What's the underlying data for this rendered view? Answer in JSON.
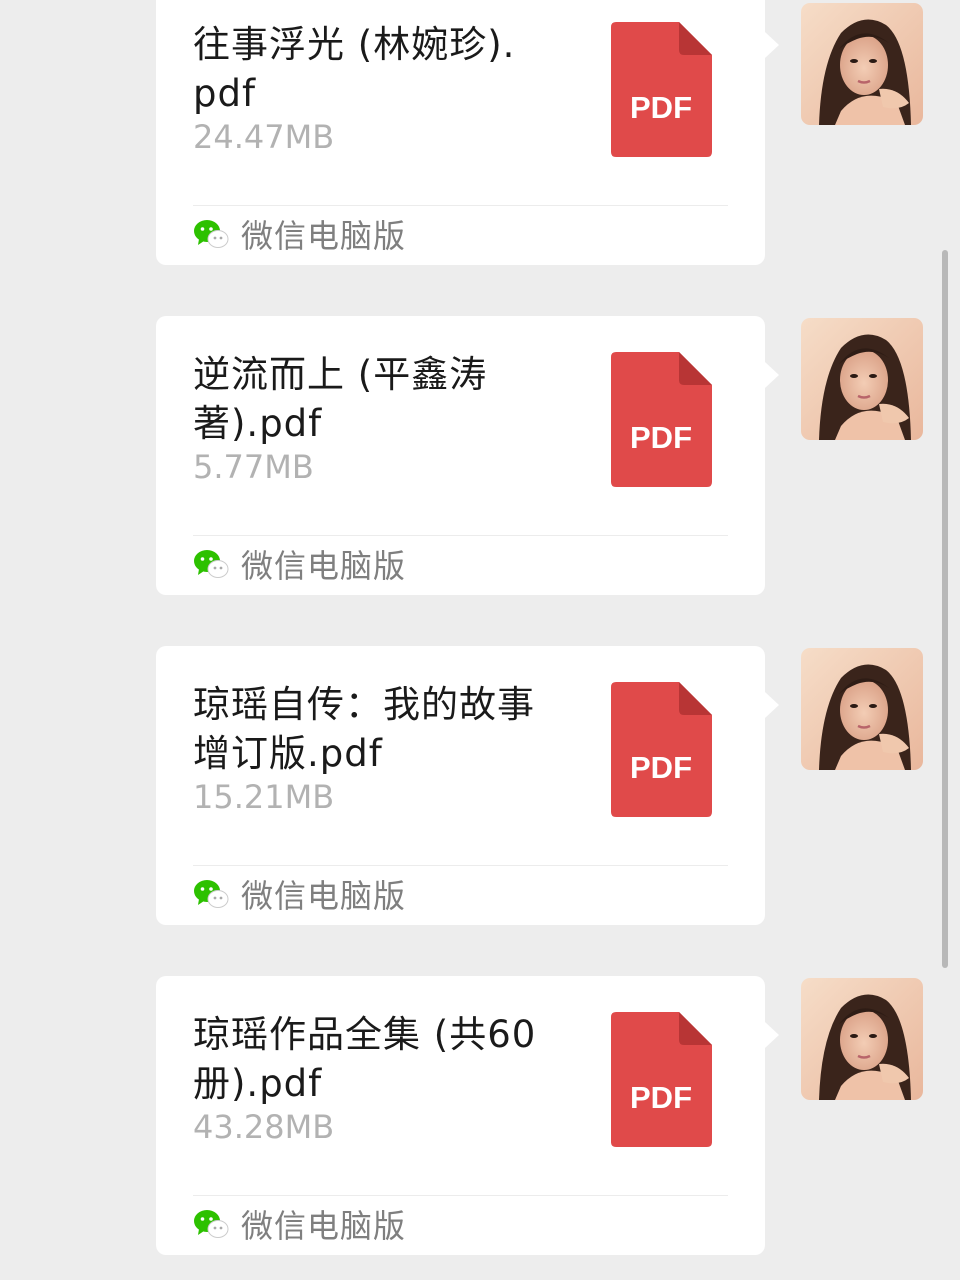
{
  "messages": [
    {
      "file_name": "往事浮光 (林婉珍).pdf",
      "file_size": "24.47MB",
      "file_type": "PDF",
      "source": "微信电脑版"
    },
    {
      "file_name": "逆流而上 (平鑫涛著).pdf",
      "file_size": "5.77MB",
      "file_type": "PDF",
      "source": "微信电脑版"
    },
    {
      "file_name": "琼瑶自传：我的故事 增订版.pdf",
      "file_size": "15.21MB",
      "file_type": "PDF",
      "source": "微信电脑版"
    },
    {
      "file_name": "琼瑶作品全集 (共60册).pdf",
      "file_size": "43.28MB",
      "file_type": "PDF",
      "source": "微信电脑版"
    }
  ],
  "colors": {
    "background": "#ededed",
    "bubble": "#ffffff",
    "pdf_red": "#e04a4a",
    "pdf_fold": "#b83535",
    "file_size_gray": "#b2b2b2",
    "source_gray": "#7f7f7f",
    "wechat_green": "#2dc100"
  },
  "icons": {
    "file": "pdf-file-icon",
    "source": "wechat-icon",
    "sender": "avatar"
  }
}
